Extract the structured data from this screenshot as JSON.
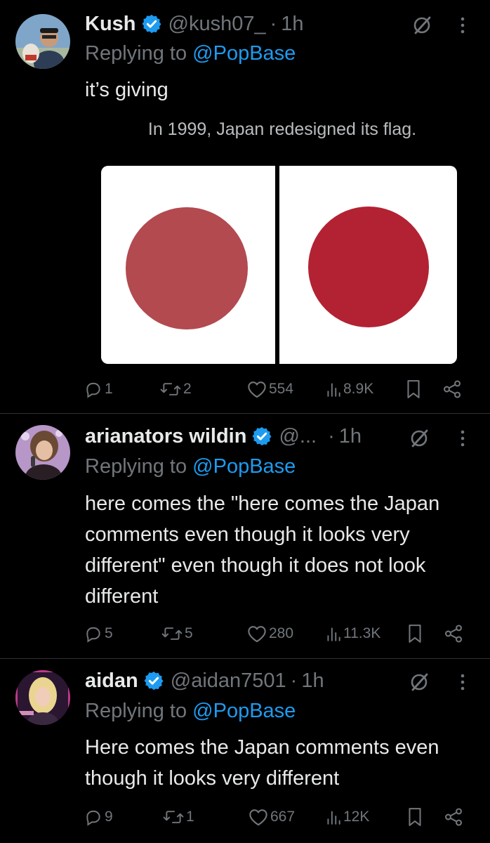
{
  "tweets": [
    {
      "name": "Kush",
      "handle": "@kush07_",
      "dot": "·",
      "time": "1h",
      "replying_prefix": "Replying to",
      "replying_to": "@PopBase",
      "text": "it’s giving",
      "actions": {
        "replies": "1",
        "reposts": "2",
        "likes": "554",
        "views": "8.9K"
      },
      "media": {
        "caption": "In 1999, Japan redesigned its flag.",
        "left_disc_color": "#b24a50",
        "right_disc_color": "#b22233"
      }
    },
    {
      "name": "arianators wildin",
      "handle": "@...",
      "dot": "·",
      "time": "1h",
      "replying_prefix": "Replying to",
      "replying_to": "@PopBase",
      "text": "here comes the \"here comes the Japan comments even though it looks very different\" even though it does not look different",
      "actions": {
        "replies": "5",
        "reposts": "5",
        "likes": "280",
        "views": "11.3K"
      }
    },
    {
      "name": "aidan",
      "handle": "@aidan7501",
      "dot": "·",
      "time": "1h",
      "replying_prefix": "Replying to",
      "replying_to": "@PopBase",
      "text": "Here comes the Japan comments even though it looks very different",
      "actions": {
        "replies": "9",
        "reposts": "1",
        "likes": "667",
        "views": "12K"
      }
    }
  ],
  "colors": {
    "background": "#000000",
    "text": "#e7e9ea",
    "muted": "#71767b",
    "link": "#1d9bf0",
    "divider": "#2f3336",
    "verified": "#1d9bf0"
  },
  "icons": [
    "verified-badge-icon",
    "grok-icon",
    "more-icon",
    "reply-icon",
    "repost-icon",
    "like-icon",
    "views-icon",
    "bookmark-icon",
    "share-icon"
  ]
}
